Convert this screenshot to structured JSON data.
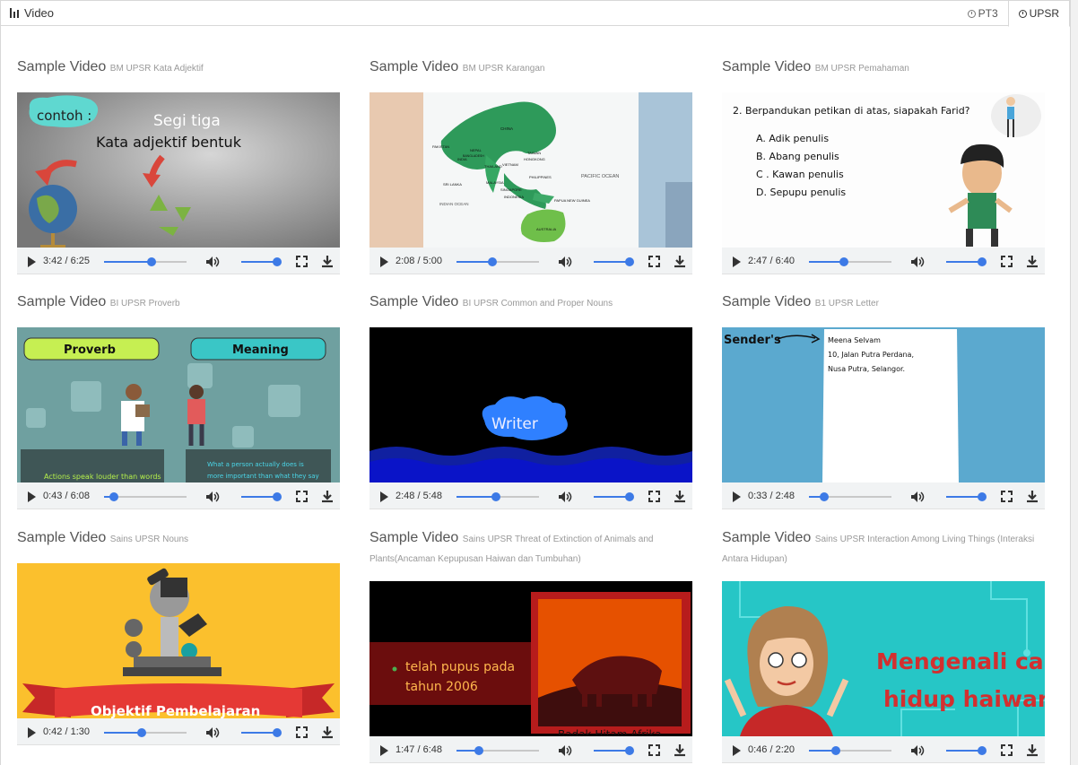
{
  "header": {
    "title": "Video",
    "tabs": [
      {
        "label": "PT3",
        "active": false
      },
      {
        "label": "UPSR",
        "active": true
      }
    ]
  },
  "videos": [
    {
      "title": "Sample Video",
      "subtitle": "BM UPSR Kata Adjektif",
      "time": "3:42 / 6:25",
      "progress": 0.58,
      "thumb": {
        "bubble": "contoh :",
        "line1": "Segi tiga",
        "line2": "Kata adjektif bentuk"
      }
    },
    {
      "title": "Sample Video",
      "subtitle": "BM UPSR Karangan",
      "time": "2:08 / 5:00",
      "progress": 0.43,
      "thumb": {
        "ocean": "PACIFIC OCEAN",
        "ocean2": "INDIAN OCEAN",
        "places": [
          "CHINA",
          "PAKISTAN",
          "INDIA",
          "NEPAL",
          "BANGLADESH",
          "TAIWAN",
          "HONGKONG",
          "VIETNAM",
          "THAILAND",
          "MALAYSIA",
          "SINGAPORE",
          "INDONESIA",
          "PHILIPPINES",
          "SRI LANKA",
          "PAPUA NEW GUINEA",
          "AUSTRALIA"
        ]
      }
    },
    {
      "title": "Sample Video",
      "subtitle": "BM UPSR Pemahaman",
      "time": "2:47 / 6:40",
      "progress": 0.42,
      "thumb": {
        "question": "2. Berpandukan petikan di atas, siapakah Farid?",
        "options": [
          "A. Adik penulis",
          "B. Abang penulis",
          "C . Kawan penulis",
          "D. Sepupu penulis"
        ]
      }
    },
    {
      "title": "Sample Video",
      "subtitle": "BI UPSR Proverb",
      "time": "0:43 / 6:08",
      "progress": 0.12,
      "thumb": {
        "left": "Proverb",
        "right": "Meaning",
        "caption1": "Actions speak louder than words",
        "caption2": "What a person actually does is more important than what they say"
      }
    },
    {
      "title": "Sample Video",
      "subtitle": "BI UPSR Common and Proper Nouns",
      "time": "2:48 / 5:48",
      "progress": 0.48,
      "thumb": {
        "word": "Writer"
      }
    },
    {
      "title": "Sample Video",
      "subtitle": "B1 UPSR Letter",
      "time": "0:33 / 2:48",
      "progress": 0.18,
      "thumb": {
        "label": "Sender's",
        "lines": [
          "Meena Selvam",
          "10, Jalan Putra Perdana,",
          "Nusa Putra, Selangor."
        ]
      }
    },
    {
      "title": "Sample Video",
      "subtitle": "Sains UPSR Nouns",
      "time": "0:42 / 1:30",
      "progress": 0.46,
      "thumb": {
        "banner": "Objektif Pembelajaran"
      }
    },
    {
      "title": "Sample Video",
      "subtitle": "Sains UPSR Threat of Extinction of Animals and Plants(Ancaman Kepupusan Haiwan dan Tumbuhan)",
      "time": "1:47 / 6:48",
      "progress": 0.27,
      "thumb": {
        "line1": "telah pupus pada",
        "line2": "tahun 2006",
        "caption": "Badak Hitam Afrika"
      }
    },
    {
      "title": "Sample Video",
      "subtitle": "Sains UPSR Interaction Among Living Things (Interaksi Antara Hidupan)",
      "time": "0:46 / 2:20",
      "progress": 0.33,
      "thumb": {
        "line1": "Mengenali cara",
        "line2": "hidup haiwan."
      }
    }
  ],
  "colors": {
    "accent": "#3d7ae6",
    "controls_bg": "#f1f3f4"
  }
}
